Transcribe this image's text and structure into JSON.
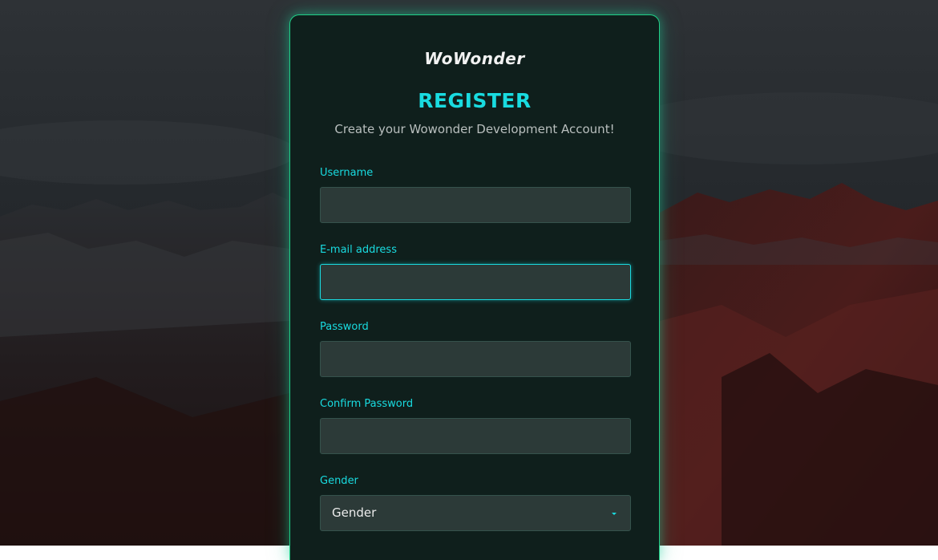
{
  "app": {
    "logo_text": "WoWonder"
  },
  "register": {
    "title": "REGISTER",
    "subtitle": "Create your Wowonder Development Account!"
  },
  "fields": {
    "username": {
      "label": "Username",
      "value": "",
      "placeholder": ""
    },
    "email": {
      "label": "E-mail address",
      "value": "",
      "placeholder": ""
    },
    "password": {
      "label": "Password",
      "value": "",
      "placeholder": ""
    },
    "confirm_password": {
      "label": "Confirm Password",
      "value": "",
      "placeholder": ""
    },
    "gender": {
      "label": "Gender",
      "selected": "Gender"
    }
  },
  "theme": {
    "accent": "#19dbe0",
    "border_glow": "#1fcf86",
    "card_bg": "#0f1f1c",
    "input_bg": "#2c3a38"
  },
  "icons": {
    "gender_caret": "chevron-down-icon"
  }
}
